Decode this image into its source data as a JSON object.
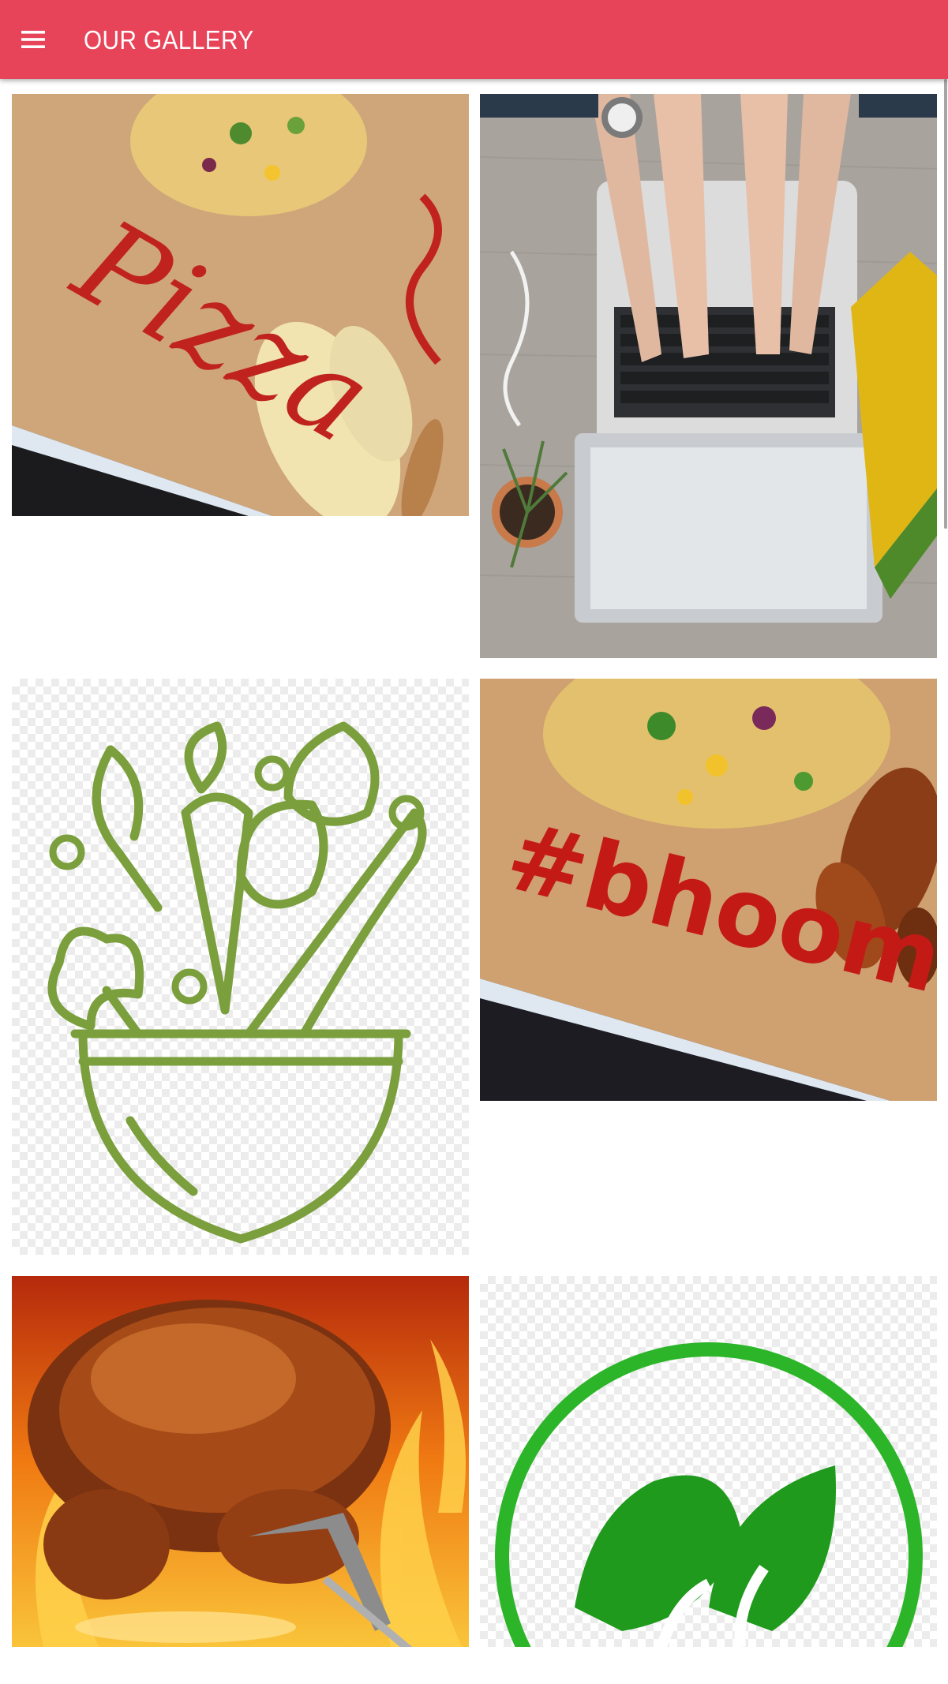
{
  "app_bar": {
    "title": "OUR GALLERY",
    "menu_icon": "hamburger-menu-icon",
    "accent_color": "#e84459"
  },
  "gallery": {
    "items": [
      {
        "subject": "pizza-board-photo",
        "board_lettering": "Pizza"
      },
      {
        "subject": "laptop-typing-photo"
      },
      {
        "subject": "vegetable-bowl-icon",
        "color": "#7a9f3c"
      },
      {
        "subject": "pizza-wings-board-photo",
        "board_lettering": "#bhoomi"
      },
      {
        "subject": "roast-chicken-photo"
      },
      {
        "subject": "vegetarian-leaf-icon",
        "color": "#2db52a"
      }
    ]
  }
}
